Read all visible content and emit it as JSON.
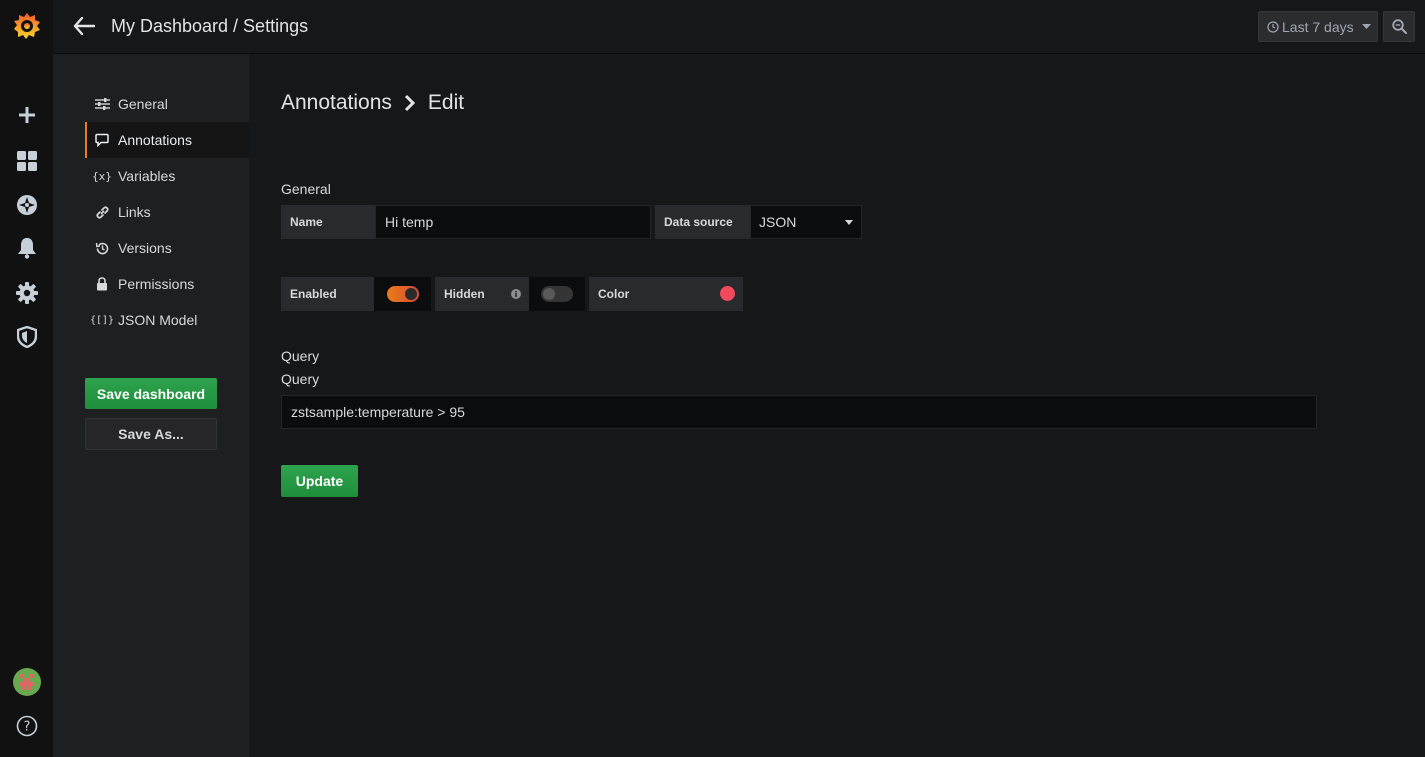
{
  "topbar": {
    "title": "My Dashboard / Settings",
    "time_range": "Last 7 days"
  },
  "rail": {
    "icons": [
      "grafana-logo-icon",
      "plus-icon",
      "dashboards-icon",
      "explore-icon",
      "bell-icon",
      "gear-icon",
      "shield-icon",
      "avatar",
      "help-icon"
    ]
  },
  "settings_nav": {
    "items": [
      {
        "label": "General",
        "icon": "sliders-icon"
      },
      {
        "label": "Annotations",
        "icon": "comment-icon"
      },
      {
        "label": "Variables",
        "icon_text": "{x}"
      },
      {
        "label": "Links",
        "icon": "link-icon"
      },
      {
        "label": "Versions",
        "icon": "history-icon"
      },
      {
        "label": "Permissions",
        "icon": "lock-icon"
      },
      {
        "label": "JSON Model",
        "icon_text": "{[]}"
      }
    ],
    "save_dashboard": "Save dashboard",
    "save_as": "Save As..."
  },
  "content": {
    "breadcrumb_parent": "Annotations",
    "breadcrumb_current": "Edit",
    "general_heading": "General",
    "name_label": "Name",
    "name_value": "Hi temp",
    "datasource_label": "Data source",
    "datasource_value": "JSON",
    "enabled_label": "Enabled",
    "enabled": true,
    "hidden_label": "Hidden",
    "hidden": false,
    "color_label": "Color",
    "color_value": "#f2495c",
    "query_heading": "Query",
    "query_label": "Query",
    "query_value": "zstsample:temperature > 95",
    "update_button": "Update"
  },
  "colors": {
    "accent_orange": "#eb7b18",
    "button_green": "#299c46"
  }
}
